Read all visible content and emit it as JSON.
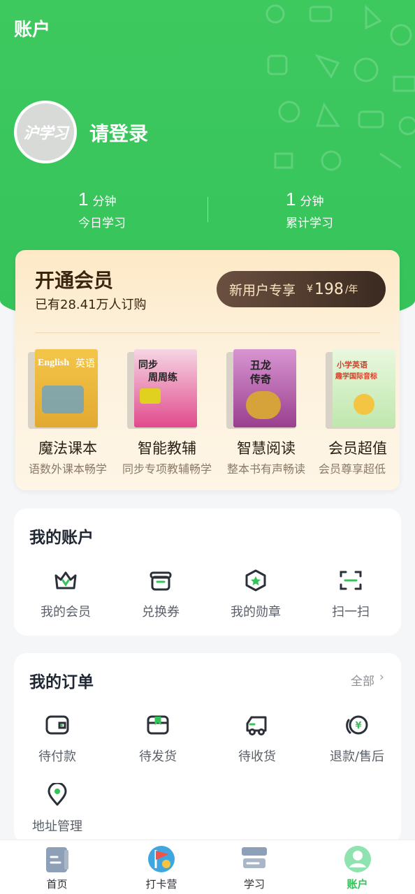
{
  "header": {
    "title": "账户"
  },
  "profile": {
    "avatar_text": "沪学习",
    "login_text": "请登录"
  },
  "stats": [
    {
      "value": "1",
      "unit": "分钟",
      "label": "今日学习"
    },
    {
      "value": "1",
      "unit": "分钟",
      "label": "累计学习"
    }
  ],
  "vip": {
    "title": "开通会员",
    "subtitle": "已有28.41万人订购",
    "pill_label": "新用户专享",
    "currency": "¥",
    "price": "198",
    "per": "/年",
    "features": [
      {
        "title": "魔法课本",
        "subtitle": "语数外课本畅学",
        "cover_text": "English 英语",
        "cover_color": "#e9b73d"
      },
      {
        "title": "智能教辅",
        "subtitle": "同步专项教辅畅学",
        "cover_text": "同步 周周练",
        "cover_color": "#e04a8c"
      },
      {
        "title": "智慧阅读",
        "subtitle": "整本书有声畅读",
        "cover_text": "丑龙 传奇",
        "cover_color": "#b04fa6"
      },
      {
        "title": "会员超值",
        "subtitle": "会员尊享超低",
        "cover_text": "小学英语 趣学国际音标",
        "cover_color": "#cfeec2"
      }
    ]
  },
  "account": {
    "title": "我的账户",
    "items": [
      {
        "label": "我的会员",
        "icon": "crown-icon"
      },
      {
        "label": "兑换券",
        "icon": "coupon-icon"
      },
      {
        "label": "我的勋章",
        "icon": "medal-icon"
      },
      {
        "label": "扫一扫",
        "icon": "scan-icon"
      }
    ]
  },
  "orders": {
    "title": "我的订单",
    "more": "全部",
    "items": [
      {
        "label": "待付款",
        "icon": "wallet-icon"
      },
      {
        "label": "待发货",
        "icon": "package-icon"
      },
      {
        "label": "待收货",
        "icon": "truck-icon"
      },
      {
        "label": "退款/售后",
        "icon": "refund-icon"
      },
      {
        "label": "地址管理",
        "icon": "location-pin-icon"
      }
    ]
  },
  "tabbar": {
    "items": [
      {
        "label": "首页",
        "icon": "home-book-icon"
      },
      {
        "label": "打卡营",
        "icon": "flag-checkin-icon"
      },
      {
        "label": "学习",
        "icon": "study-books-icon"
      },
      {
        "label": "账户",
        "icon": "account-avatar-icon"
      }
    ],
    "active": "账户"
  },
  "colors": {
    "brand_green": "#35c35a",
    "vip_gold_dark": "#3a2410",
    "pill_dark": "#4a3628"
  }
}
